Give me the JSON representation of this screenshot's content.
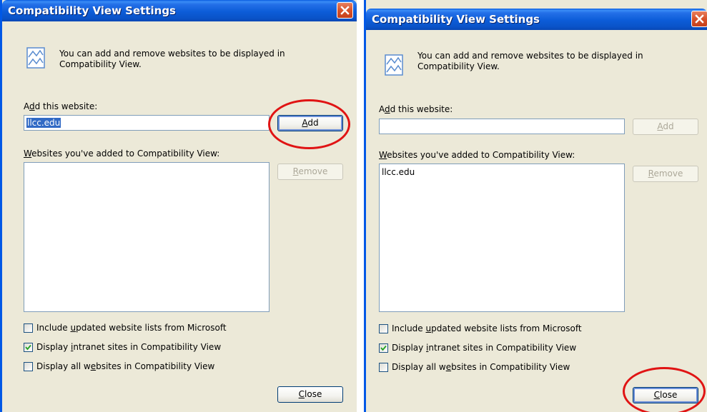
{
  "dialogs": [
    {
      "title": "Compatibility View Settings",
      "info": {
        "line1": "You can add and remove websites to be displayed in",
        "line2": "Compatibility View."
      },
      "add_label": {
        "pre": "A",
        "key": "d",
        "post": "d this website:"
      },
      "add_value": "llcc.edu",
      "add_button": {
        "key": "A",
        "post": "dd"
      },
      "list_label": {
        "key": "W",
        "post": "ebsites you've added to Compatibility View:"
      },
      "list_items": [],
      "remove_button": {
        "key": "R",
        "post": "emove"
      },
      "options": [
        {
          "pre": "Include ",
          "key": "u",
          "post": "pdated website lists from Microsoft",
          "checked": false
        },
        {
          "pre": "Display ",
          "key": "i",
          "post": "ntranet sites in Compatibility View",
          "checked": true
        },
        {
          "pre": "Display all w",
          "key": "e",
          "post": "bsites in Compatibility View",
          "checked": false
        }
      ],
      "close_button": {
        "key": "C",
        "post": "lose"
      }
    },
    {
      "title": "Compatibility View Settings",
      "info": {
        "line1": "You can add and remove websites to be displayed in",
        "line2": "Compatibility View."
      },
      "add_label": {
        "pre": "A",
        "key": "d",
        "post": "d this website:"
      },
      "add_value": "",
      "add_button": {
        "key": "A",
        "post": "dd"
      },
      "list_label": {
        "key": "W",
        "post": "ebsites you've added to Compatibility View:"
      },
      "list_items": [
        "llcc.edu"
      ],
      "remove_button": {
        "key": "R",
        "post": "emove"
      },
      "options": [
        {
          "pre": "Include ",
          "key": "u",
          "post": "pdated website lists from Microsoft",
          "checked": false
        },
        {
          "pre": "Display ",
          "key": "i",
          "post": "ntranet sites in Compatibility View",
          "checked": true
        },
        {
          "pre": "Display all w",
          "key": "e",
          "post": "bsites in Compatibility View",
          "checked": false
        }
      ],
      "close_button": {
        "key": "C",
        "post": "lose"
      }
    }
  ],
  "icons": {
    "info": "compatibility-view-icon",
    "close": "close-x-icon",
    "check": "checkmark-icon"
  },
  "colors": {
    "titlebar": "#0a5de0",
    "dialog_bg": "#ece9d8",
    "highlight_ring": "#e01414",
    "selection": "#316ac5"
  }
}
